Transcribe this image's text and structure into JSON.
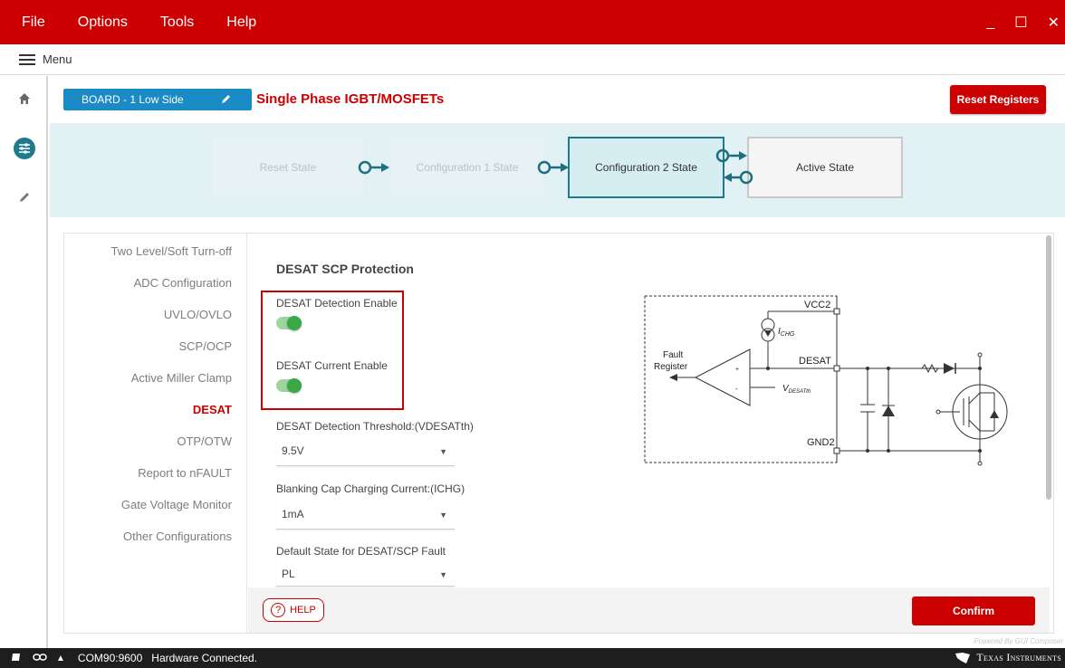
{
  "menu": {
    "items": [
      "File",
      "Options",
      "Tools",
      "Help"
    ],
    "hamburger_label": "Menu"
  },
  "window": {
    "minimize": "_",
    "maximize": "☐",
    "close": "✕"
  },
  "header": {
    "board_label": "BOARD - 1 Low Side",
    "subtitle": "Single Phase IGBT/MOSFETs",
    "reset_button": "Reset Registers"
  },
  "states": [
    {
      "label": "Reset State"
    },
    {
      "label": "Configuration 1 State"
    },
    {
      "label": "Configuration 2 State"
    },
    {
      "label": "Active State"
    }
  ],
  "sidenav": {
    "items": [
      "Two Level/Soft Turn-off",
      "ADC Configuration",
      "UVLO/OVLO",
      "SCP/OCP",
      "Active Miller Clamp",
      "DESAT",
      "OTP/OTW",
      "Report to nFAULT",
      "Gate Voltage Monitor",
      "Other Configurations"
    ],
    "selected": "DESAT"
  },
  "form": {
    "title": "DESAT SCP Protection",
    "toggles": [
      {
        "label": "DESAT Detection Enable",
        "on": true
      },
      {
        "label": "DESAT Current Enable",
        "on": true
      }
    ],
    "selects": [
      {
        "label": "DESAT Detection Threshold:(VDESATth)",
        "value": "9.5V"
      },
      {
        "label": "Blanking Cap Charging Current:(ICHG)",
        "value": "1mA"
      },
      {
        "label": "Default State for DESAT/SCP Fault",
        "value": "PL"
      }
    ]
  },
  "diagram": {
    "vcc2": "VCC2",
    "ichg": "I",
    "ichg_sub": "CHG",
    "fault": "Fault",
    "register": "Register",
    "desat": "DESAT",
    "plus": "+",
    "minus": "-",
    "vdesat": "V",
    "vdesat_sub": "DESATth",
    "gnd2": "GND2"
  },
  "footer": {
    "help": "HELP",
    "help_glyph": "?",
    "confirm": "Confirm",
    "powered": "Powered By GUI Composer"
  },
  "status": {
    "port": "COM90:9600",
    "connection": "Hardware Connected.",
    "brand": "Texas Instruments"
  },
  "colors": {
    "accent": "#cc0000",
    "board_blue": "#1a8bc4",
    "state_teal": "#1f7a8c",
    "toggle_green": "#3aa845"
  }
}
